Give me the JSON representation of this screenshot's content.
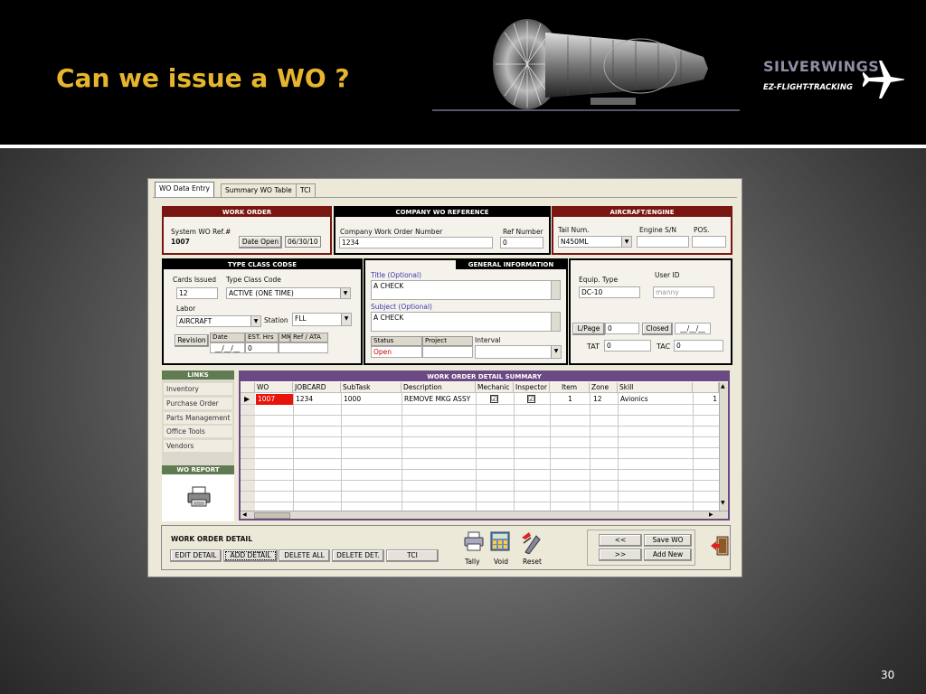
{
  "slide": {
    "title": "Can we issue a WO ?",
    "page_number": "30",
    "brand": {
      "name": "SILVERWINGS",
      "tagline": "EZ-FLIGHT-TRACKING"
    }
  },
  "tabs": [
    {
      "label": "WO Data Entry",
      "active": true
    },
    {
      "label": "Summary WO Table",
      "active": false
    },
    {
      "label": "TCI",
      "active": false
    }
  ],
  "work_order": {
    "header": "WORK ORDER",
    "system_ref_label": "System WO Ref.#",
    "system_ref_value": "1007",
    "date_open_button": "Date Open",
    "date_open_value": "06/30/10"
  },
  "company_ref": {
    "header": "COMPANY WO REFERENCE",
    "number_label": "Company Work Order Number",
    "number_value": "1234",
    "ref_number_label": "Ref Number",
    "ref_number_value": "0"
  },
  "aircraft": {
    "header": "AIRCRAFT/ENGINE",
    "tail_label": "Tail Num.",
    "tail_value": "N450ML",
    "engine_label": "Engine S/N",
    "engine_value": "",
    "pos_label": "POS.",
    "pos_value": ""
  },
  "type_class": {
    "header": "TYPE CLASS CODSE",
    "cards_label": "Cards Issued",
    "cards_value": "12",
    "type_label": "Type Class Code",
    "type_value": "ACTIVE (ONE TIME)",
    "labor_label": "Labor",
    "labor_value": "AIRCRAFT",
    "station_label": "Station",
    "station_value": "FLL",
    "revision_button": "Revision",
    "cols": [
      "Date",
      "EST. Hrs",
      "MM",
      "Ref / ATA"
    ],
    "date_value": "__/__/__",
    "est_value": "0"
  },
  "general": {
    "header": "GENERAL INFORMATION",
    "title_label": "Title (Optional)",
    "title_value": "A CHECK",
    "subject_label": "Subject (Optional)",
    "subject_value": "A CHECK",
    "status_label": "Status",
    "status_value": "Open",
    "project_label": "Project",
    "interval_label": "Interval"
  },
  "equip": {
    "type_label": "Equip. Type",
    "type_value": "DC-10",
    "user_label": "User ID",
    "user_value": "manny",
    "lpage_button": "L/Page",
    "lpage_value": "0",
    "closed_button": "Closed",
    "closed_value": "__/__/__",
    "tat_label": "TAT",
    "tat_value": "0",
    "tac_label": "TAC",
    "tac_value": "0"
  },
  "links": {
    "header": "LINKS",
    "items": [
      "Inventory",
      "Purchase Order",
      "Parts Management",
      "Office Tools",
      "Vendors"
    ],
    "report_header": "WO REPORT"
  },
  "summary": {
    "header": "WORK ORDER DETAIL SUMMARY",
    "columns": [
      "WO",
      "JOBCARD",
      "SubTask",
      "Description",
      "Mechanic",
      "Inspector",
      "Item",
      "Zone",
      "Skill"
    ],
    "row": {
      "wo": "1007",
      "jobcard": "1234",
      "subtask": "1000",
      "description": "REMOVE MKG ASSY",
      "mechanic": "☑",
      "inspector": "☑",
      "item": "1",
      "zone": "12",
      "skill": "Avionics",
      "extra": "1"
    }
  },
  "detail": {
    "label": "WORK ORDER DETAIL",
    "buttons": [
      "EDIT DETAIL",
      "ADD DETAIL",
      "DELETE ALL",
      "DELETE DET.",
      "TCI"
    ],
    "tally": "Tally",
    "void": "Void",
    "reset": "Reset",
    "prev": "<<",
    "next": ">>",
    "save": "Save WO",
    "add_new": "Add New"
  },
  "colors": {
    "accent_title": "#e7b52c",
    "panel_red": "#7a1612",
    "panel_purple": "#6b4a84",
    "links_green": "#607a52"
  }
}
